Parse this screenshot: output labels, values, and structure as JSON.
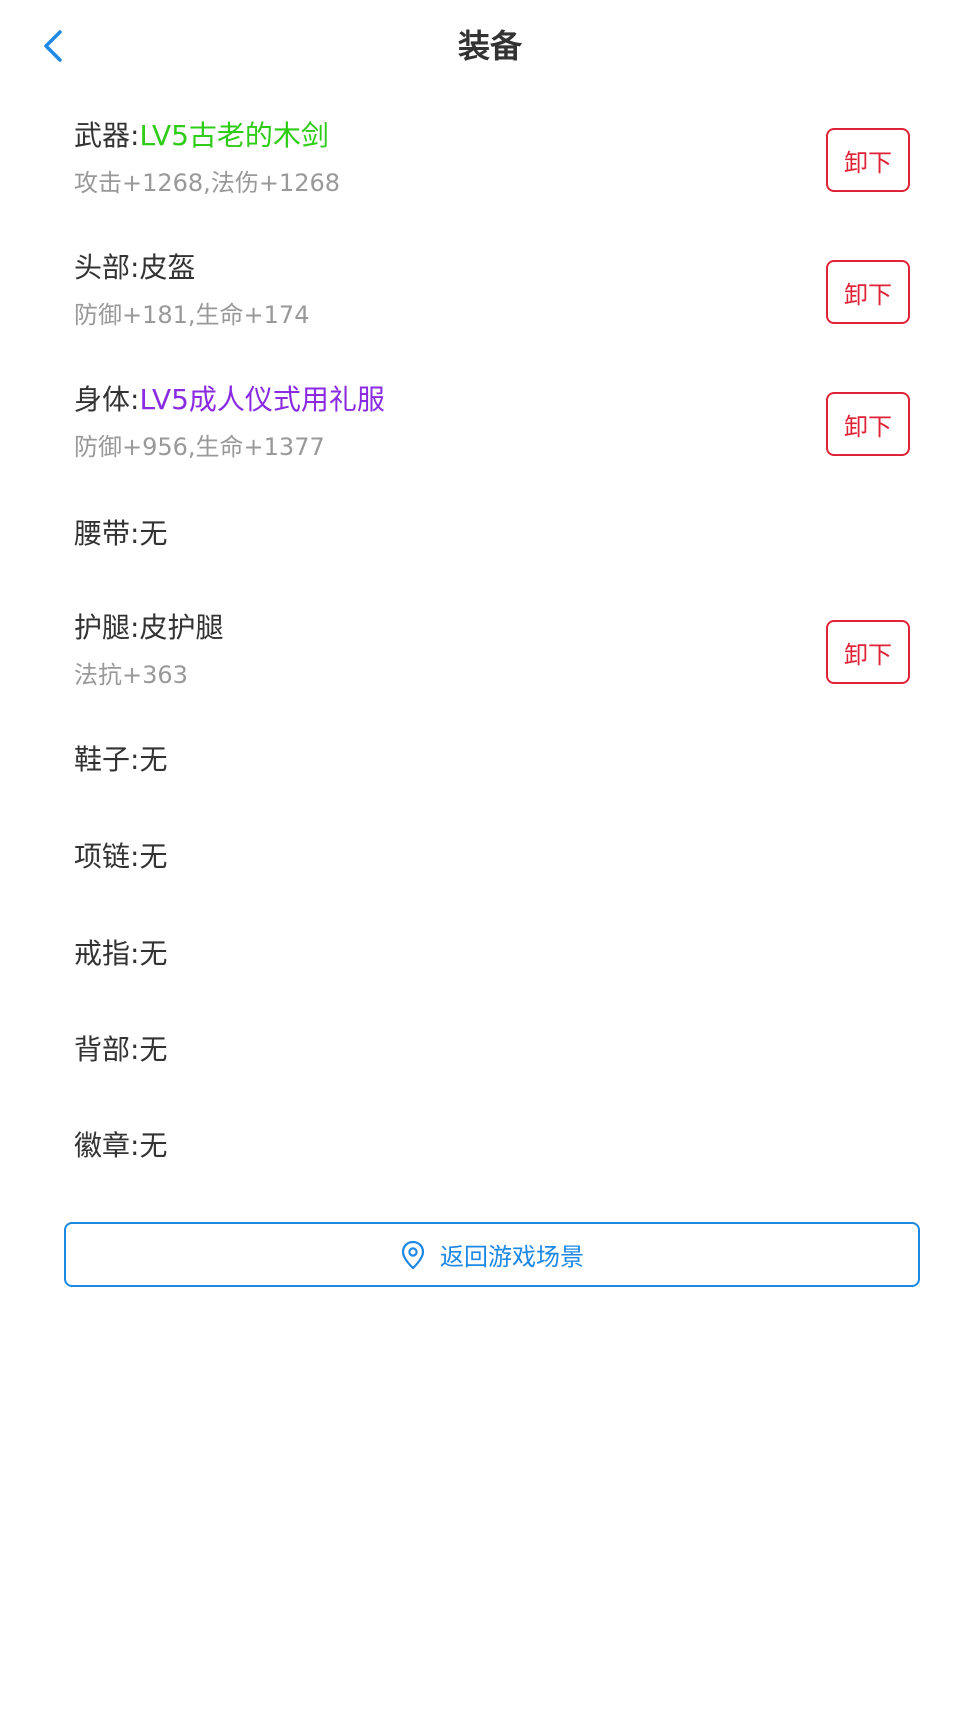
{
  "header": {
    "title": "装备"
  },
  "colors": {
    "item_green": "#2ecc17",
    "item_purple": "#8a2be2",
    "item_default": "#333333",
    "stat_gray": "#999999",
    "danger": "#e02236",
    "accent": "#1e88e5"
  },
  "slots": [
    {
      "label": "武器:",
      "item": "LV5古老的木剑",
      "stats": "攻击+1268,法伤+1268",
      "action": "卸下",
      "item_color": "green"
    },
    {
      "label": "头部:",
      "item": "皮盔",
      "stats": "防御+181,生命+174",
      "action": "卸下",
      "item_color": "default"
    },
    {
      "label": "身体:",
      "item": "LV5成人仪式用礼服",
      "stats": "防御+956,生命+1377",
      "action": "卸下",
      "item_color": "purple"
    },
    {
      "label": "腰带:",
      "item": "无"
    },
    {
      "label": "护腿:",
      "item": "皮护腿",
      "stats": "法抗+363",
      "action": "卸下",
      "item_color": "default"
    },
    {
      "label": "鞋子:",
      "item": "无"
    },
    {
      "label": "项链:",
      "item": "无"
    },
    {
      "label": "戒指:",
      "item": "无"
    },
    {
      "label": "背部:",
      "item": "无"
    },
    {
      "label": "徽章:",
      "item": "无"
    }
  ],
  "footer": {
    "return_label": "返回游戏场景",
    "return_icon": "location-pin-icon"
  }
}
